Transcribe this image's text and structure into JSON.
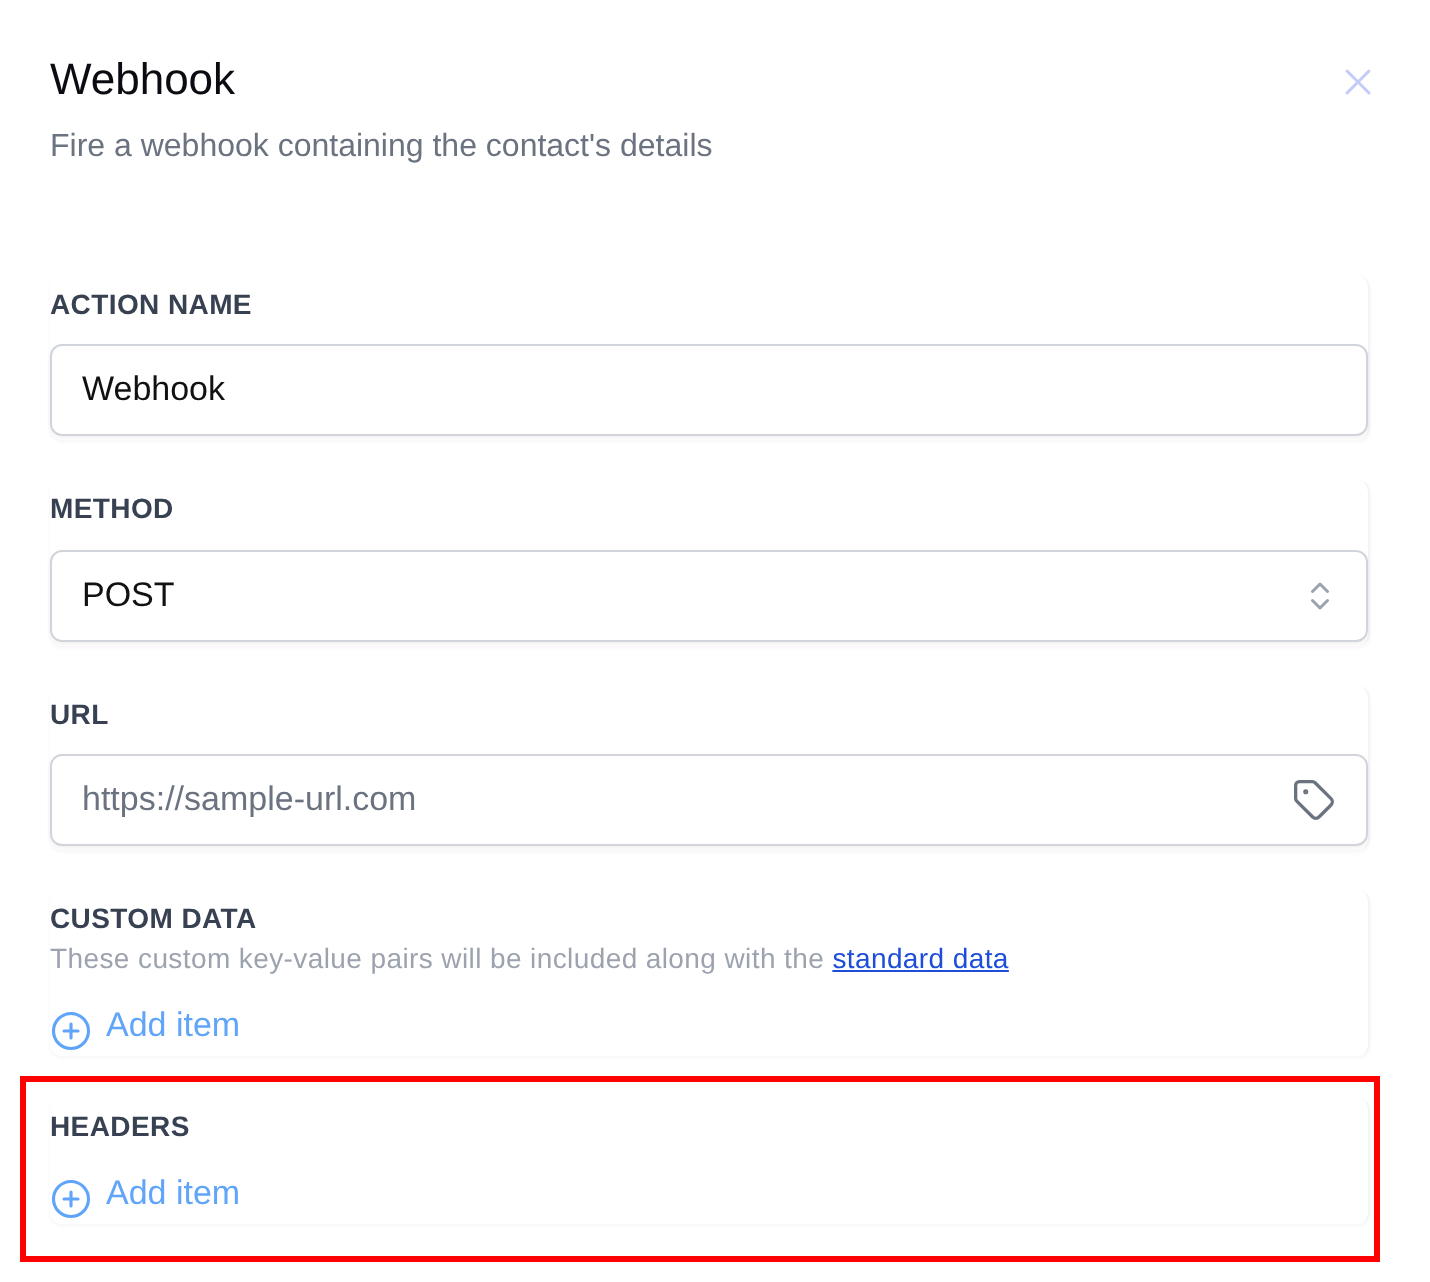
{
  "dialog": {
    "title": "Webhook",
    "subtitle": "Fire a webhook containing the contact's details"
  },
  "fields": [
    {
      "kind": "text",
      "label": "ACTION NAME",
      "value": "Webhook"
    },
    {
      "kind": "select",
      "label": "METHOD",
      "value": "POST"
    },
    {
      "kind": "tagged_text",
      "label": "URL",
      "placeholder": "https://sample-url.com"
    }
  ],
  "lists": [
    {
      "label": "CUSTOM DATA",
      "description": "These custom key-value pairs will be included along with the",
      "link": "standard data",
      "add_label": "Add item",
      "highlighted": false
    },
    {
      "label": "HEADERS",
      "add_label": "Add item",
      "highlighted": true
    }
  ]
}
